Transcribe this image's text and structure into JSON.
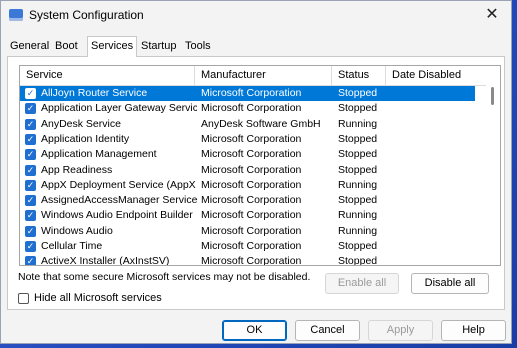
{
  "window": {
    "title": "System Configuration",
    "close_glyph": "✕"
  },
  "tabs": [
    {
      "label": "General",
      "active": false
    },
    {
      "label": "Boot",
      "active": false
    },
    {
      "label": "Services",
      "active": true
    },
    {
      "label": "Startup",
      "active": false
    },
    {
      "label": "Tools",
      "active": false
    }
  ],
  "table": {
    "columns": [
      "Service",
      "Manufacturer",
      "Status",
      "Date Disabled"
    ],
    "rows": [
      {
        "service": "AllJoyn Router Service",
        "manufacturer": "Microsoft Corporation",
        "status": "Stopped",
        "date": "",
        "checked": true,
        "selected": true
      },
      {
        "service": "Application Layer Gateway Service",
        "manufacturer": "Microsoft Corporation",
        "status": "Stopped",
        "date": "",
        "checked": true,
        "selected": false
      },
      {
        "service": "AnyDesk Service",
        "manufacturer": "AnyDesk Software GmbH",
        "status": "Running",
        "date": "",
        "checked": true,
        "selected": false
      },
      {
        "service": "Application Identity",
        "manufacturer": "Microsoft Corporation",
        "status": "Stopped",
        "date": "",
        "checked": true,
        "selected": false
      },
      {
        "service": "Application Management",
        "manufacturer": "Microsoft Corporation",
        "status": "Stopped",
        "date": "",
        "checked": true,
        "selected": false
      },
      {
        "service": "App Readiness",
        "manufacturer": "Microsoft Corporation",
        "status": "Stopped",
        "date": "",
        "checked": true,
        "selected": false
      },
      {
        "service": "AppX Deployment Service (AppX…",
        "manufacturer": "Microsoft Corporation",
        "status": "Running",
        "date": "",
        "checked": true,
        "selected": false
      },
      {
        "service": "AssignedAccessManager Service",
        "manufacturer": "Microsoft Corporation",
        "status": "Stopped",
        "date": "",
        "checked": true,
        "selected": false
      },
      {
        "service": "Windows Audio Endpoint Builder",
        "manufacturer": "Microsoft Corporation",
        "status": "Running",
        "date": "",
        "checked": true,
        "selected": false
      },
      {
        "service": "Windows Audio",
        "manufacturer": "Microsoft Corporation",
        "status": "Running",
        "date": "",
        "checked": true,
        "selected": false
      },
      {
        "service": "Cellular Time",
        "manufacturer": "Microsoft Corporation",
        "status": "Stopped",
        "date": "",
        "checked": true,
        "selected": false
      },
      {
        "service": "ActiveX Installer (AxInstSV)",
        "manufacturer": "Microsoft Corporation",
        "status": "Stopped",
        "date": "",
        "checked": true,
        "selected": false
      }
    ]
  },
  "note": "Note that some secure Microsoft services may not be disabled.",
  "enable_all": "Enable all",
  "disable_all": "Disable all",
  "hide_ms": {
    "label": "Hide all Microsoft services",
    "checked": false
  },
  "footer": {
    "ok": "OK",
    "cancel": "Cancel",
    "apply": "Apply",
    "help": "Help"
  },
  "colors": {
    "selection": "#0078d7",
    "checkbox": "#1f6fd1"
  }
}
